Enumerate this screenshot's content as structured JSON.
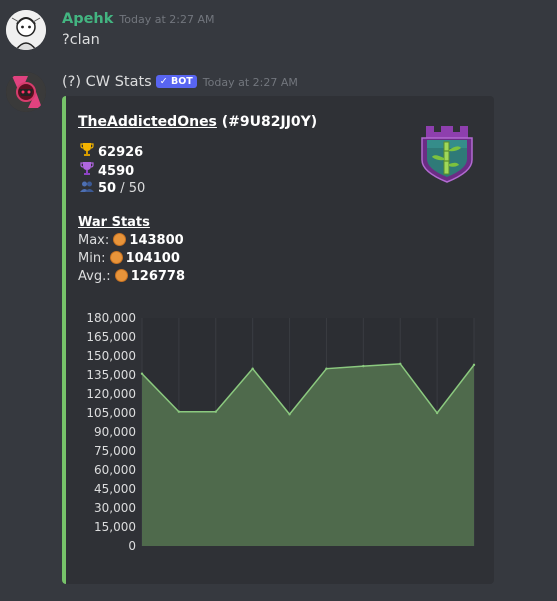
{
  "messages": [
    {
      "username": "Apehk",
      "username_color": "#43b581",
      "timestamp": "Today at 2:27 AM",
      "text": "?clan"
    },
    {
      "username": "(?) CW Stats",
      "username_color": "#dcddde",
      "badge": "✓ BOT",
      "timestamp": "Today at 2:27 AM"
    }
  ],
  "embed": {
    "accent_color": "#77c36a",
    "clan_name": "TheAddictedOnes",
    "clan_tag": "(#9U82JJ0Y)",
    "trophies": "62926",
    "war_trophies": "4590",
    "members": "50",
    "members_max": "/ 50",
    "war_stats_title": "War Stats",
    "max_label": "Max:",
    "max_value": "143800",
    "min_label": "Min:",
    "min_value": "104100",
    "avg_label": "Avg.:",
    "avg_value": "126778",
    "icons": {
      "trophy": "trophy-icon",
      "war_trophy": "war-trophy-icon",
      "members": "members-icon",
      "medal": "medal-icon",
      "badge": "clan-badge-icon"
    }
  },
  "chart_data": {
    "type": "area",
    "values": [
      136000,
      106000,
      106000,
      140000,
      104000,
      140000,
      142000,
      143800,
      105000,
      143000
    ],
    "ylim": [
      0,
      180000
    ],
    "yticks": [
      "0",
      "15,000",
      "30,000",
      "45,000",
      "60,000",
      "75,000",
      "90,000",
      "105,000",
      "120,000",
      "135,000",
      "150,000",
      "165,000",
      "180,000"
    ],
    "ytick_values": [
      0,
      15000,
      30000,
      45000,
      60000,
      75000,
      90000,
      105000,
      120000,
      135000,
      150000,
      165000,
      180000
    ],
    "line_color": "#8bc97f",
    "fill_color": "#4f6a4c",
    "grid": true,
    "xlabel": "",
    "ylabel": ""
  }
}
